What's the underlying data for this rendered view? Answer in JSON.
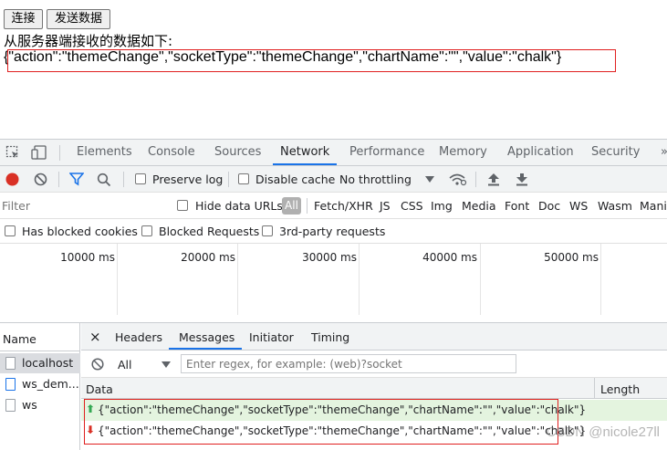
{
  "page": {
    "connect_label": "连接",
    "send_label": "发送数据",
    "received_label": "从服务器端接收的数据如下:",
    "received_data": "{\"action\":\"themeChange\",\"socketType\":\"themeChange\",\"chartName\":\"\",\"value\":\"chalk\"}"
  },
  "devtools": {
    "tabs": [
      {
        "label": "Elements"
      },
      {
        "label": "Console"
      },
      {
        "label": "Sources"
      },
      {
        "label": "Network"
      },
      {
        "label": "Performance"
      },
      {
        "label": "Memory"
      },
      {
        "label": "Application"
      },
      {
        "label": "Security"
      }
    ],
    "more_tabs_glyph": "»",
    "toolbar": {
      "preserve_log": "Preserve log",
      "disable_cache": "Disable cache",
      "throttling": "No throttling"
    },
    "filter": {
      "placeholder": "Filter",
      "hide_data_urls": "Hide data URLs",
      "types": [
        "All",
        "Fetch/XHR",
        "JS",
        "CSS",
        "Img",
        "Media",
        "Font",
        "Doc",
        "WS",
        "Wasm",
        "Mani"
      ]
    },
    "blocked": {
      "has_blocked_cookies": "Has blocked cookies",
      "blocked_requests": "Blocked Requests",
      "third_party": "3rd-party requests"
    },
    "timeline": [
      "10000 ms",
      "20000 ms",
      "30000 ms",
      "40000 ms",
      "50000 ms"
    ],
    "requests": {
      "header": "Name",
      "items": [
        "localhost",
        "ws_dem...",
        "ws"
      ]
    },
    "detail": {
      "tabs": [
        "Headers",
        "Messages",
        "Initiator",
        "Timing"
      ],
      "close_glyph": "×",
      "message_filter": "All",
      "regex_placeholder": "Enter regex, for example: (web)?socket",
      "columns": [
        "Data",
        "Length"
      ],
      "messages": [
        {
          "direction": "sent",
          "arrow": "⬆",
          "data": "{\"action\":\"themeChange\",\"socketType\":\"themeChange\",\"chartName\":\"\",\"value\":\"chalk\"}"
        },
        {
          "direction": "received",
          "arrow": "⬇",
          "data": "{\"action\":\"themeChange\",\"socketType\":\"themeChange\",\"chartName\":\"\",\"value\":\"chalk\"}"
        }
      ]
    }
  },
  "watermark": "CSDN @nicole27ll",
  "colors": {
    "accent": "#1a73e8",
    "record": "#d93025",
    "sent_bg": "#e4f4df",
    "sent_arrow": "#34a853",
    "received_arrow": "#d93025",
    "highlight_box": "#e02020"
  }
}
